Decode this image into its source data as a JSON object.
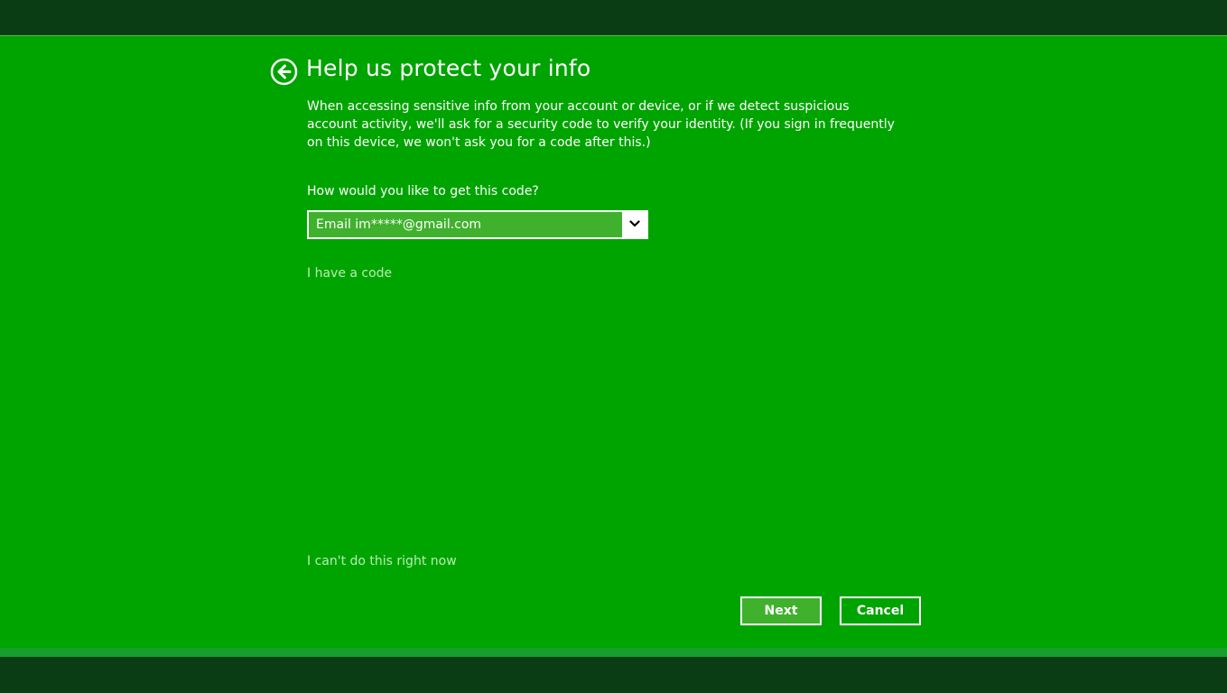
{
  "dialog": {
    "title": "Help us protect your info",
    "description": "When accessing sensitive info from your account or device, or if we detect suspicious account activity, we'll ask for a security code to verify your identity. (If you sign in frequently on this device, we won't ask you for a code after this.)",
    "question": "How would you like to get this code?",
    "method_select": {
      "selected": "Email im*****@gmail.com",
      "icon": "chevron-down-icon"
    },
    "have_code_link": "I have a code",
    "cant_do_link": "I can't do this right now",
    "back_icon": "back-arrow-circle-icon"
  },
  "buttons": {
    "next_label": "Next",
    "cancel_label": "Cancel"
  },
  "colors": {
    "accent_background": "#00a400",
    "dark_band": "#0a3d14",
    "link": "#b7eeb1",
    "button_highlight": "#3fb12d"
  }
}
